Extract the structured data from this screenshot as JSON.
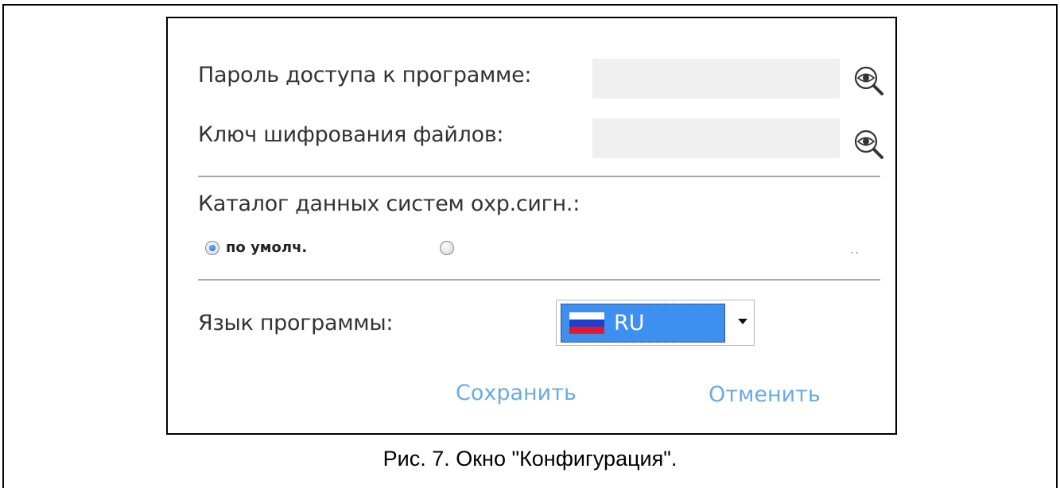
{
  "dialog": {
    "password_label": "Пароль доступа к программе:",
    "password_value": "",
    "encryption_key_label": "Ключ шифрования файлов:",
    "encryption_key_value": "",
    "reveal_icon": "magnifier-eye-icon",
    "data_dir_label": "Каталог данных систем охр.сигн.:",
    "data_dir_options": [
      {
        "label": "по умолч.",
        "checked": true
      },
      {
        "label": "",
        "checked": false
      }
    ],
    "browse_label": "..",
    "language_label": "Язык программы:",
    "language_selected": "RU",
    "language_flag": "russia-flag-icon",
    "save_label": "Сохранить",
    "cancel_label": "Отменить"
  },
  "colors": {
    "accent": "#3d8ff0",
    "link": "#6aaae6",
    "field_bg": "#f0f0f0"
  },
  "caption": "Рис. 7. Окно \"Конфигурация\"."
}
